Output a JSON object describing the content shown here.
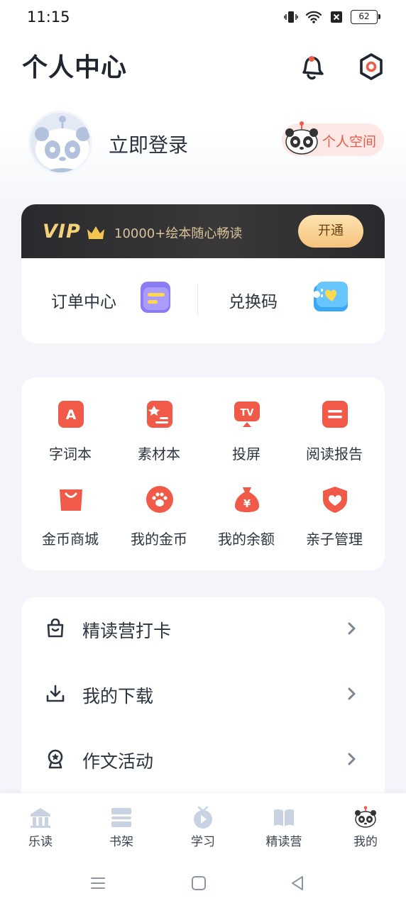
{
  "status": {
    "time": "11:15",
    "battery": "62"
  },
  "header": {
    "title": "个人中心"
  },
  "profile": {
    "login_label": "立即登录",
    "space_label": "个人空间"
  },
  "vip": {
    "logo": "VIP",
    "slogan": "10000+绘本随心畅读",
    "open_label": "开通",
    "order_label": "订单中心",
    "redeem_label": "兑换码"
  },
  "tools": [
    {
      "label": "字词本",
      "icon": "letter-a-icon"
    },
    {
      "label": "素材本",
      "icon": "material-book-icon"
    },
    {
      "label": "投屏",
      "icon": "tv-cast-icon"
    },
    {
      "label": "阅读报告",
      "icon": "report-icon"
    },
    {
      "label": "金币商城",
      "icon": "shopping-bag-icon"
    },
    {
      "label": "我的金币",
      "icon": "paw-coin-icon"
    },
    {
      "label": "我的余额",
      "icon": "money-bag-icon"
    },
    {
      "label": "亲子管理",
      "icon": "heart-shield-icon"
    }
  ],
  "menu": [
    {
      "label": "精读营打卡",
      "icon": "checkin-bag-icon"
    },
    {
      "label": "我的下载",
      "icon": "download-icon"
    },
    {
      "label": "作文活动",
      "icon": "trophy-icon"
    }
  ],
  "tabs": [
    {
      "label": "乐读",
      "icon": "house-icon"
    },
    {
      "label": "书架",
      "icon": "bookshelf-icon"
    },
    {
      "label": "学习",
      "icon": "play-tv-icon"
    },
    {
      "label": "精读营",
      "icon": "open-book-icon"
    },
    {
      "label": "我的",
      "icon": "panda-icon"
    }
  ],
  "colors": {
    "accent": "#f15a48",
    "tab_inactive": "#c9d2e2",
    "vip_gold": "#f4d27a"
  }
}
